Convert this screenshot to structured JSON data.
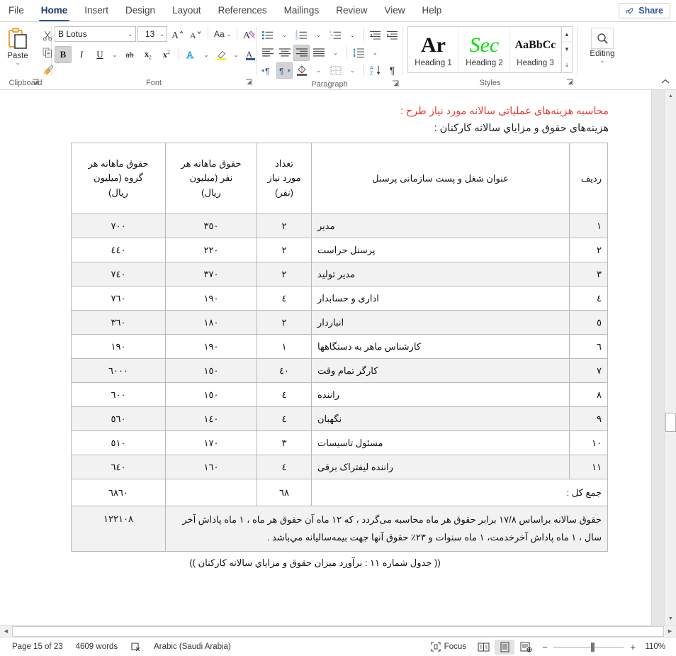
{
  "window": {
    "tabs": [
      "File",
      "Home",
      "Insert",
      "Design",
      "Layout",
      "References",
      "Mailings",
      "Review",
      "View",
      "Help"
    ],
    "active_tab": "Home",
    "share_label": "Share"
  },
  "ribbon": {
    "groups": [
      {
        "label": "Clipboard"
      },
      {
        "label": "Font"
      },
      {
        "label": "Paragraph"
      },
      {
        "label": "Styles"
      }
    ],
    "clipboard": {
      "paste_label": "Paste",
      "cut_title": "Cut",
      "copy_title": "Copy",
      "format_painter_title": "Format Painter"
    },
    "font": {
      "font_name": "B Lotus",
      "font_size": "13",
      "grow_title": "Increase Font Size",
      "shrink_title": "Decrease Font Size",
      "change_case": "Aa",
      "clear_formatting_title": "Clear All Formatting",
      "bold": "B",
      "italic": "I",
      "underline": "U",
      "strikethrough": "ab",
      "subscript": "x",
      "superscript": "x",
      "text_effects": "A",
      "highlight": "A",
      "font_color": "A"
    },
    "paragraph": {
      "bullets_title": "Bullets",
      "numbering_title": "Numbering",
      "multilevel_title": "Multilevel List",
      "decrease_indent_title": "Decrease Indent",
      "increase_indent_title": "Increase Indent",
      "align_left_title": "Align Left",
      "align_center_title": "Center",
      "align_right_title": "Align Right",
      "justify_title": "Justify",
      "line_spacing_title": "Line and Paragraph Spacing",
      "ltr_title": "Left-to-Right Text Direction",
      "rtl_title": "Right-to-Left Text Direction",
      "shading_title": "Shading",
      "borders_title": "Borders",
      "sort_title": "Sort",
      "show_marks_title": "Show/Hide Formatting Marks"
    },
    "styles": {
      "items": [
        {
          "preview": "Ar",
          "name": "Heading 1"
        },
        {
          "preview": "Sec",
          "name": "Heading 2"
        },
        {
          "preview": "AaBbCc",
          "name": "Heading 3"
        }
      ]
    },
    "editing": {
      "label": "Editing"
    }
  },
  "document": {
    "heading_red": "محاسبه هزینه‌های عملیاتی سالانه مورد نیاز طرح :",
    "heading_sub": "هزینه‌های حقوق و مزایاي سالانه کارکنان :",
    "table": {
      "headers": {
        "radif": "ردیف",
        "title": "عنوان شغل و پست سازمانی پرسنل",
        "count": "تعداد مورد نیاز (نفر)",
        "count_lines": [
          "تعداد",
          "مورد نیاز",
          "(نفر)"
        ],
        "per_person": "حقوق ماهانه هر نفر (میلیون ریال)",
        "per_person_lines": [
          "حقوق ماهانه هر",
          "نفر (میلیون",
          "ریال)"
        ],
        "per_group": "حقوق ماهانه هر گروه (میلیون ریال)",
        "per_group_lines": [
          "حقوق ماهانه هر",
          "گروه (میلیون",
          "ریال)"
        ]
      },
      "rows": [
        {
          "radif": "١",
          "title": "مدیر",
          "count": "٢",
          "per_person": "٣٥٠",
          "per_group": "٧٠٠"
        },
        {
          "radif": "٢",
          "title": "پرسنل حراست",
          "count": "٢",
          "per_person": "٢٢٠",
          "per_group": "٤٤٠"
        },
        {
          "radif": "٣",
          "title": "مدیر تولید",
          "count": "٢",
          "per_person": "٣٧٠",
          "per_group": "٧٤٠"
        },
        {
          "radif": "٤",
          "title": "اداری و حسابدار",
          "count": "٤",
          "per_person": "١٩٠",
          "per_group": "٧٦٠"
        },
        {
          "radif": "٥",
          "title": "انباردار",
          "count": "٢",
          "per_person": "١٨٠",
          "per_group": "٣٦٠"
        },
        {
          "radif": "٦",
          "title": "کارشناس ماهر به دستگاهها",
          "count": "١",
          "per_person": "١٩٠",
          "per_group": "١٩٠"
        },
        {
          "radif": "٧",
          "title": "کارگر تمام وقت",
          "count": "٤٠",
          "per_person": "١٥٠",
          "per_group": "٦٠٠٠"
        },
        {
          "radif": "٨",
          "title": "راننده",
          "count": "٤",
          "per_person": "١٥٠",
          "per_group": "٦٠٠"
        },
        {
          "radif": "٩",
          "title": "نگهبان",
          "count": "٤",
          "per_person": "١٤٠",
          "per_group": "٥٦٠"
        },
        {
          "radif": "١٠",
          "title": "مسئول تاسیسات",
          "count": "٣",
          "per_person": "١٧٠",
          "per_group": "٥١٠"
        },
        {
          "radif": "١١",
          "title": "راننده لیفتراک برقی",
          "count": "٤",
          "per_person": "١٦٠",
          "per_group": "٦٤٠"
        }
      ],
      "total_row": {
        "label": "جمع کل :",
        "count": "٦٨",
        "per_person": "",
        "per_group": "٦٨٦٠"
      },
      "note_row": {
        "note": "حقوق سالانه براساس ١٧/٨ برابر حقوق هر ماه محاسبه  می‌گردد ، که ١٢ ماه آن حقوق هر ماه ، ١ ماه پاداش آخر سال ، ١ ماه پاداش آخرخدمت، ١ ماه سنوات و ٢٣٪ حقوق آنها جهت بیمه‌سالیانه مي‌باشد .",
        "value": "١٢٢١٠٨"
      }
    },
    "caption": "(( جدول شماره ١١ : برآورد میزان حقوق و مزایاي سالانه کارکنان ))"
  },
  "status": {
    "page": "Page 15 of 23",
    "words": "4609 words",
    "proofing_title": "Proofing errors",
    "language": "Arabic (Saudi Arabia)",
    "focus": "Focus",
    "view_read_title": "Read Mode",
    "view_print_title": "Print Layout",
    "view_web_title": "Web Layout",
    "zoom_out": "−",
    "zoom_in": "+",
    "zoom_value": "110%"
  },
  "colors": {
    "accent": "#2b579a",
    "heading_red": "#e8392f",
    "row_shade": "#f2f2f2",
    "table_border": "#b8b8b8"
  }
}
